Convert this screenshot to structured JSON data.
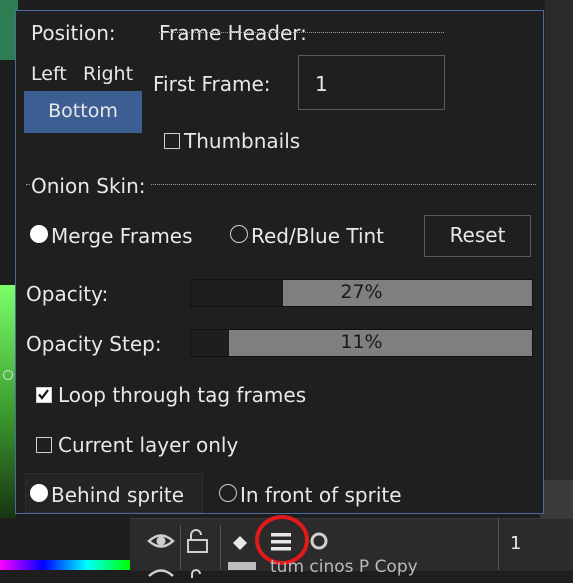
{
  "colors": {
    "selected_bg": "#3c5e93",
    "highlight_circle": "#e0191b",
    "panel_border": "#4a6aa0"
  },
  "position": {
    "label": "Position:",
    "left_label": "Left",
    "right_label": "Right",
    "bottom_label": "Bottom",
    "selected": "Bottom"
  },
  "frame_header": {
    "label": "Frame Header:",
    "first_frame_label": "First Frame:",
    "first_frame_value": "1",
    "thumbnails_label": "Thumbnails",
    "thumbnails_checked": false
  },
  "onion_skin": {
    "label": "Onion Skin:",
    "merge_frames_label": "Merge Frames",
    "red_blue_tint_label": "Red/Blue Tint",
    "mode_selected": "Merge Frames",
    "reset_label": "Reset",
    "opacity_label": "Opacity:",
    "opacity_value": "27%",
    "opacity_fraction": 0.27,
    "opacity_step_label": "Opacity Step:",
    "opacity_step_value": "11%",
    "opacity_step_fraction": 0.11,
    "loop_label": "Loop through tag frames",
    "loop_checked": true,
    "current_layer_label": "Current layer only",
    "current_layer_checked": false,
    "behind_sprite_label": "Behind sprite",
    "in_front_label": "In front of sprite",
    "placement_selected": "Behind sprite"
  },
  "timeline": {
    "icons": [
      "eye-icon",
      "padlock-icon",
      "diamond-icon",
      "menu-icon",
      "circle-icon"
    ],
    "frame_number": "1",
    "layer_name": "tum cinos P Copy"
  }
}
